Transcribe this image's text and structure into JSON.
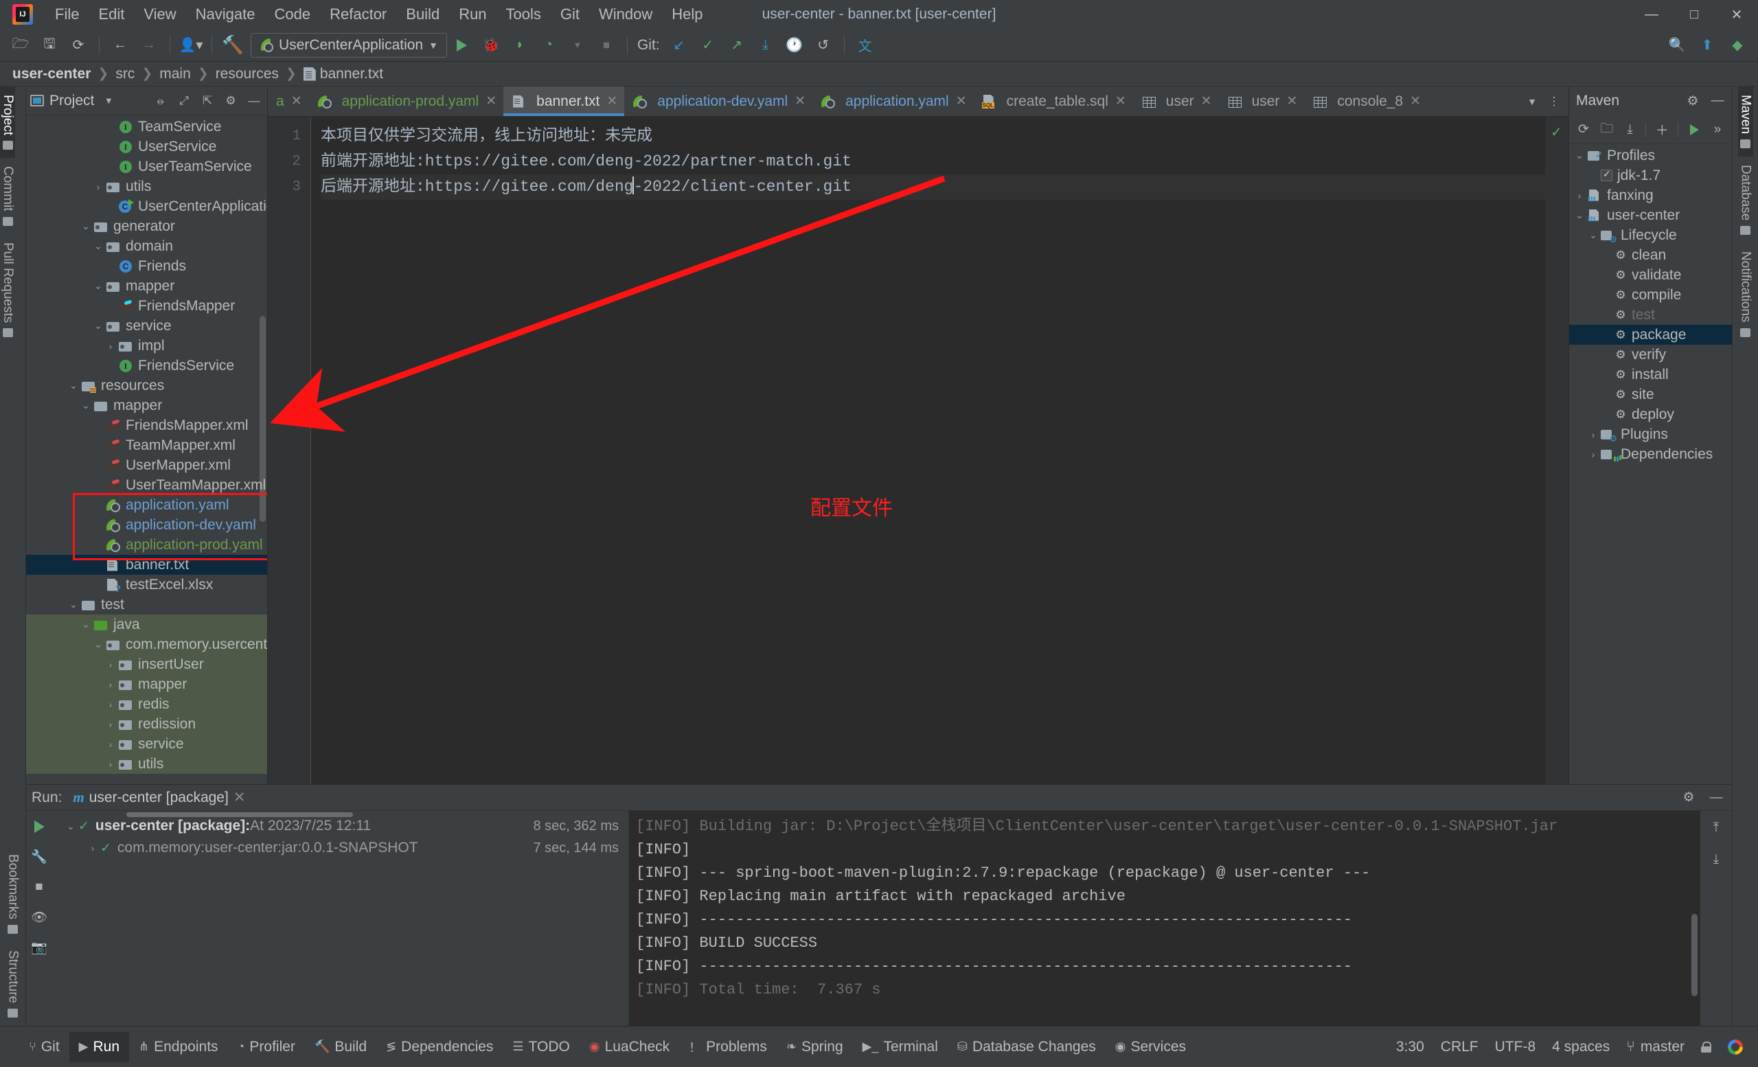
{
  "window": {
    "title": "user-center - banner.txt [user-center]",
    "minimize": "—",
    "maximize": "□",
    "close": "✕"
  },
  "menu": {
    "items": [
      "File",
      "Edit",
      "View",
      "Navigate",
      "Code",
      "Refactor",
      "Build",
      "Run",
      "Tools",
      "Git",
      "Window",
      "Help"
    ]
  },
  "toolbar": {
    "open_icon": "open-folder-icon",
    "save_icon": "save-icon",
    "sync_icon": "sync-icon",
    "back_icon": "back-arrow-icon",
    "forward_icon": "forward-arrow-icon",
    "profile_icon": "user-profile-icon",
    "build_icon": "build-hammer-icon",
    "run_config_name": "UserCenterApplication",
    "run_icon": "run-play-icon",
    "debug_icon": "debug-bug-icon",
    "coverage_icon": "run-coverage-icon",
    "profiler_icon": "profiler-icon",
    "stop_icon": "stop-square-icon",
    "git_label": "Git:",
    "git_update_icon": "git-update-icon",
    "git_commit_icon": "git-commit-check-icon",
    "git_push_icon": "git-push-icon",
    "git_pull_icon": "git-pull-icon",
    "git_history_icon": "git-history-clock-icon",
    "git_rollback_icon": "git-rollback-icon",
    "translate_icon": "translate-icon",
    "search_icon": "search-everywhere-icon",
    "updates_icon": "updates-badge-icon",
    "ide_icon": "ide-status-icon"
  },
  "breadcrumb": {
    "items": [
      "user-center",
      "src",
      "main",
      "resources",
      "banner.txt"
    ],
    "separator": "❯",
    "file_icon": "txt-file-icon"
  },
  "left_rail": {
    "top": [
      "Project",
      "Commit",
      "Pull Requests"
    ],
    "bottom": [
      "Bookmarks",
      "Structure"
    ]
  },
  "project_panel": {
    "title": "Project",
    "window_icon": "project-window-icon",
    "dropdown_icon": "chevron-down-icon",
    "settings_icon": "gear-icon",
    "collapse_icon": "collapse-all-icon",
    "expand_icon": "expand-all-icon",
    "hide_icon": "hide-panel-icon",
    "tree": [
      {
        "label": "TeamService",
        "indent": 6,
        "icon": "interface",
        "arrow": "none",
        "color": ""
      },
      {
        "label": "UserService",
        "indent": 6,
        "icon": "interface",
        "arrow": "none",
        "color": ""
      },
      {
        "label": "UserTeamService",
        "indent": 6,
        "icon": "interface",
        "arrow": "none",
        "color": ""
      },
      {
        "label": "utils",
        "indent": 5,
        "icon": "folder",
        "arrow": "collapsed",
        "color": ""
      },
      {
        "label": "UserCenterApplication",
        "indent": 6,
        "icon": "springclass",
        "arrow": "none",
        "color": ""
      },
      {
        "label": "generator",
        "indent": 4,
        "icon": "folder",
        "arrow": "expanded",
        "color": ""
      },
      {
        "label": "domain",
        "indent": 5,
        "icon": "folder",
        "arrow": "expanded",
        "color": ""
      },
      {
        "label": "Friends",
        "indent": 6,
        "icon": "class",
        "arrow": "none",
        "color": ""
      },
      {
        "label": "mapper",
        "indent": 5,
        "icon": "folder",
        "arrow": "expanded",
        "color": ""
      },
      {
        "label": "FriendsMapper",
        "indent": 6,
        "icon": "mybatis",
        "arrow": "none",
        "color": ""
      },
      {
        "label": "service",
        "indent": 5,
        "icon": "folder",
        "arrow": "expanded",
        "color": ""
      },
      {
        "label": "impl",
        "indent": 6,
        "icon": "folder",
        "arrow": "collapsed",
        "color": ""
      },
      {
        "label": "FriendsService",
        "indent": 6,
        "icon": "interface",
        "arrow": "none",
        "color": ""
      },
      {
        "label": "resources",
        "indent": 3,
        "icon": "folder-res",
        "arrow": "expanded",
        "color": ""
      },
      {
        "label": "mapper",
        "indent": 4,
        "icon": "folder-plain",
        "arrow": "expanded",
        "color": ""
      },
      {
        "label": "FriendsMapper.xml",
        "indent": 5,
        "icon": "mybatis-red",
        "arrow": "none",
        "color": ""
      },
      {
        "label": "TeamMapper.xml",
        "indent": 5,
        "icon": "mybatis-red",
        "arrow": "none",
        "color": ""
      },
      {
        "label": "UserMapper.xml",
        "indent": 5,
        "icon": "mybatis-red",
        "arrow": "none",
        "color": ""
      },
      {
        "label": "UserTeamMapper.xml",
        "indent": 5,
        "icon": "mybatis-red",
        "arrow": "none",
        "color": ""
      },
      {
        "label": "application.yaml",
        "indent": 5,
        "icon": "yaml",
        "arrow": "none",
        "color": "blue"
      },
      {
        "label": "application-dev.yaml",
        "indent": 5,
        "icon": "yaml",
        "arrow": "none",
        "color": "blue"
      },
      {
        "label": "application-prod.yaml",
        "indent": 5,
        "icon": "yaml",
        "arrow": "none",
        "color": "green"
      },
      {
        "label": "banner.txt",
        "indent": 5,
        "icon": "txtfile",
        "arrow": "none",
        "color": "",
        "selected": true
      },
      {
        "label": "testExcel.xlsx",
        "indent": 5,
        "icon": "xlsx",
        "arrow": "none",
        "color": ""
      },
      {
        "label": "test",
        "indent": 3,
        "icon": "folder-plain",
        "arrow": "expanded",
        "color": ""
      },
      {
        "label": "java",
        "indent": 4,
        "icon": "folder-green",
        "arrow": "expanded",
        "color": "",
        "greenbg": true
      },
      {
        "label": "com.memory.usercenter",
        "indent": 5,
        "icon": "folder",
        "arrow": "expanded",
        "color": "",
        "greenbg": true
      },
      {
        "label": "insertUser",
        "indent": 6,
        "icon": "folder",
        "arrow": "collapsed",
        "color": "",
        "greenbg": true
      },
      {
        "label": "mapper",
        "indent": 6,
        "icon": "folder",
        "arrow": "collapsed",
        "color": "",
        "greenbg": true
      },
      {
        "label": "redis",
        "indent": 6,
        "icon": "folder",
        "arrow": "collapsed",
        "color": "",
        "greenbg": true
      },
      {
        "label": "redission",
        "indent": 6,
        "icon": "folder",
        "arrow": "collapsed",
        "color": "",
        "greenbg": true
      },
      {
        "label": "service",
        "indent": 6,
        "icon": "folder",
        "arrow": "collapsed",
        "color": "",
        "greenbg": true
      },
      {
        "label": "utils",
        "indent": 6,
        "icon": "folder",
        "arrow": "collapsed",
        "color": "",
        "greenbg": true
      }
    ]
  },
  "editor": {
    "tabs": [
      {
        "label": "a",
        "icon": "yaml",
        "color": "green",
        "active": false,
        "truncated": true
      },
      {
        "label": "application-prod.yaml",
        "icon": "yaml",
        "color": "green",
        "active": false
      },
      {
        "label": "banner.txt",
        "icon": "txtfile",
        "color": "",
        "active": true
      },
      {
        "label": "application-dev.yaml",
        "icon": "yaml",
        "color": "blue",
        "active": false
      },
      {
        "label": "application.yaml",
        "icon": "yaml",
        "color": "blue",
        "active": false
      },
      {
        "label": "create_table.sql",
        "icon": "sql",
        "color": "",
        "active": false
      },
      {
        "label": "user",
        "icon": "table",
        "color": "",
        "active": false
      },
      {
        "label": "user",
        "icon": "table",
        "color": "",
        "active": false
      },
      {
        "label": "console_8",
        "icon": "table",
        "color": "",
        "active": false
      }
    ],
    "tab_close": "✕",
    "tab_overflow_icon": "chevron-down-icon",
    "tab_options_icon": "more-options-icon",
    "line_numbers": [
      "1",
      "2",
      "3"
    ],
    "lines": [
      "本项目仅供学习交流用，线上访问地址：未完成",
      "前端开源地址:https://gitee.com/deng-2022/partner-match.git",
      "后端开源地址:https://gitee.com/deng-2022/client-center.git"
    ],
    "caret_line": 3,
    "inspection_status_icon": "inspection-ok-check"
  },
  "annotation": {
    "text": "配置文件",
    "color": "#ff1f1f"
  },
  "maven": {
    "title": "Maven",
    "settings_icon": "gear-icon",
    "hide_icon": "minimize-icon",
    "reload_icon": "reload-all-projects-icon",
    "add_folder_icon": "add-maven-project-icon",
    "download_icon": "download-sources-icon",
    "plus_icon": "plus-icon",
    "run_icon": "run-maven-build-icon",
    "more_icon": "expand-more-icon",
    "tree": [
      {
        "label": "Profiles",
        "indent": 0,
        "icon": "profiles",
        "arrow": "expanded"
      },
      {
        "label": "jdk-1.7",
        "indent": 1,
        "icon": "checkbox",
        "arrow": "none"
      },
      {
        "label": "fanxing",
        "indent": 0,
        "icon": "mvnmodule",
        "arrow": "collapsed"
      },
      {
        "label": "user-center",
        "indent": 0,
        "icon": "mvnmodule",
        "arrow": "expanded"
      },
      {
        "label": "Lifecycle",
        "indent": 1,
        "icon": "lifecycle",
        "arrow": "expanded"
      },
      {
        "label": "clean",
        "indent": 2,
        "icon": "gear",
        "arrow": "none"
      },
      {
        "label": "validate",
        "indent": 2,
        "icon": "gear",
        "arrow": "none"
      },
      {
        "label": "compile",
        "indent": 2,
        "icon": "gear",
        "arrow": "none"
      },
      {
        "label": "test",
        "indent": 2,
        "icon": "gear",
        "arrow": "none",
        "dim": true
      },
      {
        "label": "package",
        "indent": 2,
        "icon": "gear",
        "arrow": "none",
        "selected": true
      },
      {
        "label": "verify",
        "indent": 2,
        "icon": "gear",
        "arrow": "none"
      },
      {
        "label": "install",
        "indent": 2,
        "icon": "gear",
        "arrow": "none"
      },
      {
        "label": "site",
        "indent": 2,
        "icon": "gear",
        "arrow": "none"
      },
      {
        "label": "deploy",
        "indent": 2,
        "icon": "gear",
        "arrow": "none"
      },
      {
        "label": "Plugins",
        "indent": 1,
        "icon": "lifecycle",
        "arrow": "collapsed"
      },
      {
        "label": "Dependencies",
        "indent": 1,
        "icon": "deps",
        "arrow": "collapsed"
      }
    ]
  },
  "right_rail": {
    "items": [
      "Maven",
      "Database",
      "Notifications"
    ]
  },
  "run_panel": {
    "label": "Run:",
    "tab_title": "user-center [package]",
    "tab_icon": "maven-m-icon",
    "tab_close": "✕",
    "settings_icon": "gear-icon",
    "hide_icon": "minimize-icon",
    "rerun_icon": "rerun-play-icon",
    "tool_wrench_icon": "settings-wrench-icon",
    "tool_stop_icon": "stop-icon",
    "tool_eye_icon": "toggle-visibility-icon",
    "tool_camera_icon": "snapshot-icon",
    "rows": [
      {
        "arrow": "expanded",
        "check": "✓",
        "bold": "user-center [package]:",
        "muted": "At 2023/7/25 12:11",
        "duration": "8 sec, 362 ms"
      },
      {
        "arrow": "collapsed",
        "check": "✓",
        "bold": "",
        "muted": "com.memory:user-center:jar:0.0.1-SNAPSHOT",
        "duration": "7 sec, 144 ms"
      }
    ],
    "console_lines": [
      "[INFO] Building jar: D:\\Project\\全栈项目\\ClientCenter\\user-center\\target\\user-center-0.0.1-SNAPSHOT.jar",
      "[INFO] ",
      "[INFO] --- spring-boot-maven-plugin:2.7.9:repackage (repackage) @ user-center ---",
      "[INFO] Replacing main artifact with repackaged archive",
      "[INFO] ------------------------------------------------------------------------",
      "[INFO] BUILD SUCCESS",
      "[INFO] ------------------------------------------------------------------------",
      "[INFO] Total time:  7.367 s"
    ],
    "console_tools": [
      "up-icon",
      "down-icon"
    ]
  },
  "status_bar": {
    "tools": [
      {
        "label": "Git",
        "icon": "git-branch-icon",
        "active": false
      },
      {
        "label": "Run",
        "icon": "run-play-icon",
        "active": true
      },
      {
        "label": "Endpoints",
        "icon": "endpoints-icon",
        "active": false
      },
      {
        "label": "Profiler",
        "icon": "profiler-icon",
        "active": false
      },
      {
        "label": "Build",
        "icon": "build-hammer-icon",
        "active": false
      },
      {
        "label": "Dependencies",
        "icon": "dependencies-icon",
        "active": false
      },
      {
        "label": "TODO",
        "icon": "todo-list-icon",
        "active": false
      },
      {
        "label": "LuaCheck",
        "icon": "luacheck-icon",
        "active": false
      },
      {
        "label": "Problems",
        "icon": "problems-icon",
        "active": false
      },
      {
        "label": "Spring",
        "icon": "spring-leaf-icon",
        "active": false
      },
      {
        "label": "Terminal",
        "icon": "terminal-icon",
        "active": false
      },
      {
        "label": "Database Changes",
        "icon": "database-changes-icon",
        "active": false
      },
      {
        "label": "Services",
        "icon": "services-icon",
        "active": false
      }
    ],
    "caret_position": "3:30",
    "line_separator": "CRLF",
    "encoding": "UTF-8",
    "indent": "4 spaces",
    "branch": "master",
    "branch_icon": "git-branch-icon",
    "lock_icon": "read-only-lock-icon",
    "account_icon": "google-account-icon"
  }
}
